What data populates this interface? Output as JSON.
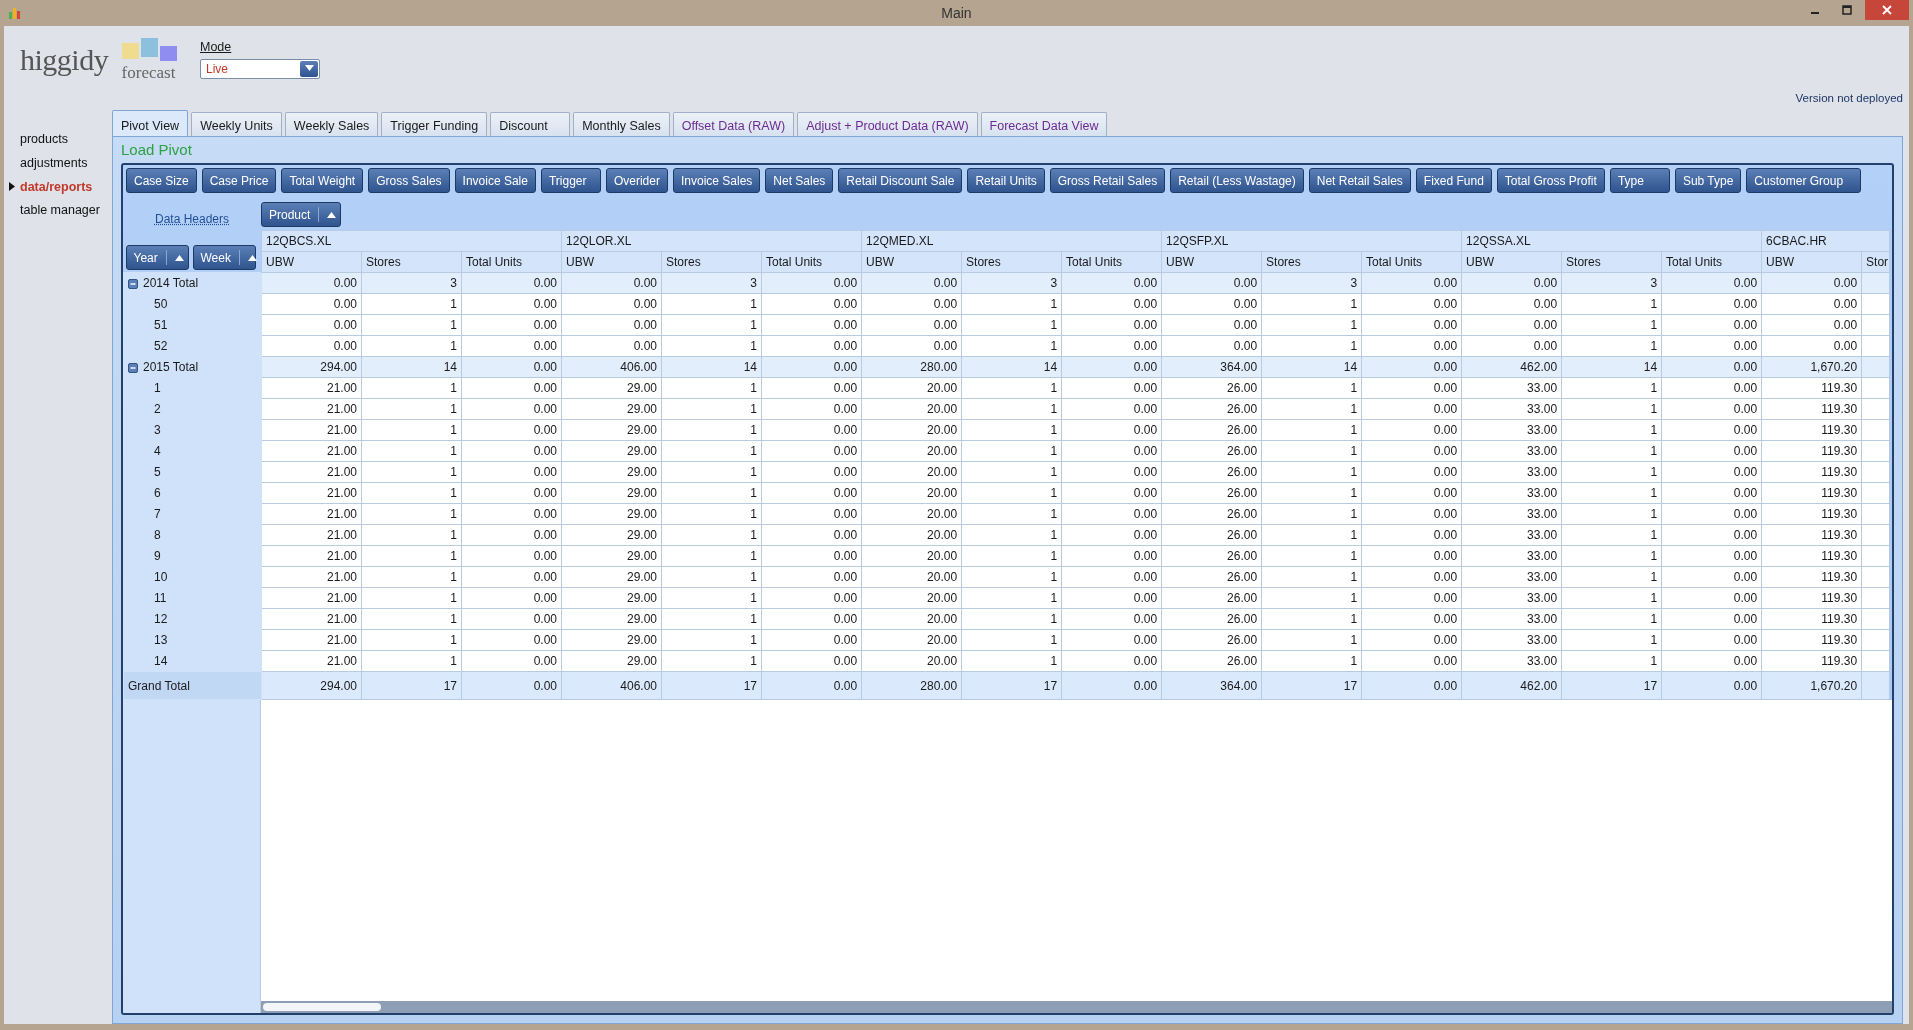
{
  "window": {
    "title": "Main"
  },
  "logo": {
    "name": "higgidy",
    "subtitle": "forecast"
  },
  "mode": {
    "label": "Mode",
    "value": "Live"
  },
  "version": "Version not deployed",
  "sidebar": {
    "items": [
      {
        "label": "products",
        "selected": false
      },
      {
        "label": "adjustments",
        "selected": false
      },
      {
        "label": "data/reports",
        "selected": true
      },
      {
        "label": "table manager",
        "selected": false
      }
    ]
  },
  "tabs": [
    {
      "label": "Pivot View",
      "selected": true,
      "color": "#1a1a1a"
    },
    {
      "label": "Weekly Units",
      "selected": false,
      "color": "#1a1a1a"
    },
    {
      "label": "Weekly Sales",
      "selected": false,
      "color": "#1a1a1a"
    },
    {
      "label": "Trigger Funding",
      "selected": false,
      "color": "#1a1a1a"
    },
    {
      "label": "Discount",
      "selected": false,
      "color": "#1a1a1a"
    },
    {
      "label": "Monthly Sales",
      "selected": false,
      "color": "#1a1a1a"
    },
    {
      "label": "Offset Data (RAW)",
      "selected": false,
      "color": "#6b2c91"
    },
    {
      "label": "Adjust + Product Data (RAW)",
      "selected": false,
      "color": "#6b2c91"
    },
    {
      "label": "Forecast Data View",
      "selected": false,
      "color": "#6b2c91"
    }
  ],
  "panel": {
    "title": "Load Pivot"
  },
  "field_buttons": [
    "Case Size",
    "Case Price",
    "Total Weight",
    "Gross Sales",
    "Invoice Sale",
    "Trigger",
    "Overider",
    "Invoice Sales",
    "Net Sales",
    "Retail Discount Sale",
    "Retail Units",
    "Gross Retail Sales",
    "Retail (Less Wastage)",
    "Net Retail Sales",
    "Fixed Fund",
    "Total Gross Profit",
    "Type",
    "Sub Type",
    "Customer Group"
  ],
  "data_headers_link": "Data Headers",
  "column_fields": [
    "Product"
  ],
  "row_fields": [
    "Year",
    "Week"
  ],
  "products": [
    {
      "name": "12QBCS.XL",
      "columns": [
        "UBW",
        "Stores",
        "Total Units"
      ]
    },
    {
      "name": "12QLOR.XL",
      "columns": [
        "UBW",
        "Stores",
        "Total Units"
      ]
    },
    {
      "name": "12QMED.XL",
      "columns": [
        "UBW",
        "Stores",
        "Total Units"
      ]
    },
    {
      "name": "12QSFP.XL",
      "columns": [
        "UBW",
        "Stores",
        "Total Units"
      ]
    },
    {
      "name": "12QSSA.XL",
      "columns": [
        "UBW",
        "Stores",
        "Total Units"
      ]
    },
    {
      "name": "6CBAC.HR",
      "columns": [
        "UBW",
        "Stor"
      ]
    }
  ],
  "rows": [
    {
      "label": "2014 Total",
      "kind": "year_total",
      "expanded": true,
      "cells": [
        "0.00",
        "3",
        "0.00",
        "0.00",
        "3",
        "0.00",
        "0.00",
        "3",
        "0.00",
        "0.00",
        "3",
        "0.00",
        "0.00",
        "3",
        "0.00",
        "0.00"
      ]
    },
    {
      "label": "50",
      "kind": "week",
      "cells": [
        "0.00",
        "1",
        "0.00",
        "0.00",
        "1",
        "0.00",
        "0.00",
        "1",
        "0.00",
        "0.00",
        "1",
        "0.00",
        "0.00",
        "1",
        "0.00",
        "0.00"
      ]
    },
    {
      "label": "51",
      "kind": "week",
      "cells": [
        "0.00",
        "1",
        "0.00",
        "0.00",
        "1",
        "0.00",
        "0.00",
        "1",
        "0.00",
        "0.00",
        "1",
        "0.00",
        "0.00",
        "1",
        "0.00",
        "0.00"
      ]
    },
    {
      "label": "52",
      "kind": "week",
      "cells": [
        "0.00",
        "1",
        "0.00",
        "0.00",
        "1",
        "0.00",
        "0.00",
        "1",
        "0.00",
        "0.00",
        "1",
        "0.00",
        "0.00",
        "1",
        "0.00",
        "0.00"
      ]
    },
    {
      "label": "2015 Total",
      "kind": "year_total",
      "expanded": true,
      "cells": [
        "294.00",
        "14",
        "0.00",
        "406.00",
        "14",
        "0.00",
        "280.00",
        "14",
        "0.00",
        "364.00",
        "14",
        "0.00",
        "462.00",
        "14",
        "0.00",
        "1,670.20"
      ]
    },
    {
      "label": "1",
      "kind": "week",
      "cells": [
        "21.00",
        "1",
        "0.00",
        "29.00",
        "1",
        "0.00",
        "20.00",
        "1",
        "0.00",
        "26.00",
        "1",
        "0.00",
        "33.00",
        "1",
        "0.00",
        "119.30"
      ]
    },
    {
      "label": "2",
      "kind": "week",
      "cells": [
        "21.00",
        "1",
        "0.00",
        "29.00",
        "1",
        "0.00",
        "20.00",
        "1",
        "0.00",
        "26.00",
        "1",
        "0.00",
        "33.00",
        "1",
        "0.00",
        "119.30"
      ]
    },
    {
      "label": "3",
      "kind": "week",
      "cells": [
        "21.00",
        "1",
        "0.00",
        "29.00",
        "1",
        "0.00",
        "20.00",
        "1",
        "0.00",
        "26.00",
        "1",
        "0.00",
        "33.00",
        "1",
        "0.00",
        "119.30"
      ]
    },
    {
      "label": "4",
      "kind": "week",
      "cells": [
        "21.00",
        "1",
        "0.00",
        "29.00",
        "1",
        "0.00",
        "20.00",
        "1",
        "0.00",
        "26.00",
        "1",
        "0.00",
        "33.00",
        "1",
        "0.00",
        "119.30"
      ]
    },
    {
      "label": "5",
      "kind": "week",
      "cells": [
        "21.00",
        "1",
        "0.00",
        "29.00",
        "1",
        "0.00",
        "20.00",
        "1",
        "0.00",
        "26.00",
        "1",
        "0.00",
        "33.00",
        "1",
        "0.00",
        "119.30"
      ]
    },
    {
      "label": "6",
      "kind": "week",
      "cells": [
        "21.00",
        "1",
        "0.00",
        "29.00",
        "1",
        "0.00",
        "20.00",
        "1",
        "0.00",
        "26.00",
        "1",
        "0.00",
        "33.00",
        "1",
        "0.00",
        "119.30"
      ]
    },
    {
      "label": "7",
      "kind": "week",
      "cells": [
        "21.00",
        "1",
        "0.00",
        "29.00",
        "1",
        "0.00",
        "20.00",
        "1",
        "0.00",
        "26.00",
        "1",
        "0.00",
        "33.00",
        "1",
        "0.00",
        "119.30"
      ]
    },
    {
      "label": "8",
      "kind": "week",
      "cells": [
        "21.00",
        "1",
        "0.00",
        "29.00",
        "1",
        "0.00",
        "20.00",
        "1",
        "0.00",
        "26.00",
        "1",
        "0.00",
        "33.00",
        "1",
        "0.00",
        "119.30"
      ]
    },
    {
      "label": "9",
      "kind": "week",
      "cells": [
        "21.00",
        "1",
        "0.00",
        "29.00",
        "1",
        "0.00",
        "20.00",
        "1",
        "0.00",
        "26.00",
        "1",
        "0.00",
        "33.00",
        "1",
        "0.00",
        "119.30"
      ]
    },
    {
      "label": "10",
      "kind": "week",
      "cells": [
        "21.00",
        "1",
        "0.00",
        "29.00",
        "1",
        "0.00",
        "20.00",
        "1",
        "0.00",
        "26.00",
        "1",
        "0.00",
        "33.00",
        "1",
        "0.00",
        "119.30"
      ]
    },
    {
      "label": "11",
      "kind": "week",
      "cells": [
        "21.00",
        "1",
        "0.00",
        "29.00",
        "1",
        "0.00",
        "20.00",
        "1",
        "0.00",
        "26.00",
        "1",
        "0.00",
        "33.00",
        "1",
        "0.00",
        "119.30"
      ]
    },
    {
      "label": "12",
      "kind": "week",
      "cells": [
        "21.00",
        "1",
        "0.00",
        "29.00",
        "1",
        "0.00",
        "20.00",
        "1",
        "0.00",
        "26.00",
        "1",
        "0.00",
        "33.00",
        "1",
        "0.00",
        "119.30"
      ]
    },
    {
      "label": "13",
      "kind": "week",
      "cells": [
        "21.00",
        "1",
        "0.00",
        "29.00",
        "1",
        "0.00",
        "20.00",
        "1",
        "0.00",
        "26.00",
        "1",
        "0.00",
        "33.00",
        "1",
        "0.00",
        "119.30"
      ]
    },
    {
      "label": "14",
      "kind": "week",
      "cells": [
        "21.00",
        "1",
        "0.00",
        "29.00",
        "1",
        "0.00",
        "20.00",
        "1",
        "0.00",
        "26.00",
        "1",
        "0.00",
        "33.00",
        "1",
        "0.00",
        "119.30"
      ]
    },
    {
      "label": "Grand Total",
      "kind": "grand_total",
      "cells": [
        "294.00",
        "17",
        "0.00",
        "406.00",
        "17",
        "0.00",
        "280.00",
        "17",
        "0.00",
        "364.00",
        "17",
        "0.00",
        "462.00",
        "17",
        "0.00",
        "1,670.20"
      ]
    }
  ]
}
